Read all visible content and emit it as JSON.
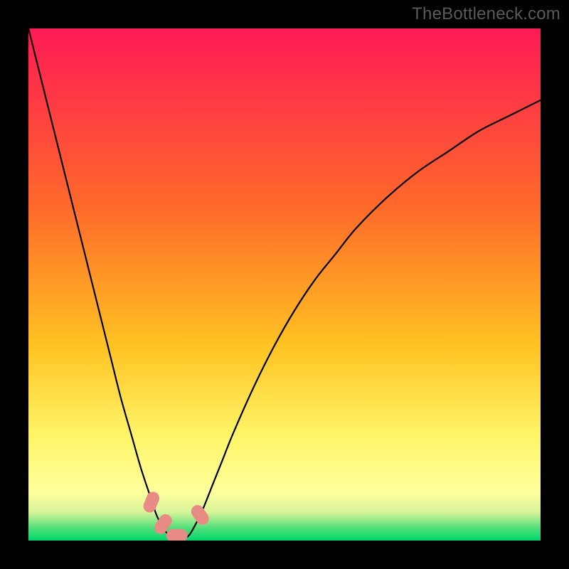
{
  "watermark": "TheBottleneck.com",
  "chart_data": {
    "type": "line",
    "title": "",
    "xlabel": "",
    "ylabel": "",
    "xlim": [
      0,
      100
    ],
    "ylim": [
      0,
      100
    ],
    "grid": false,
    "legend": false,
    "background_gradient": {
      "stops": [
        {
          "offset": 0.0,
          "color": "#ff1a55"
        },
        {
          "offset": 0.35,
          "color": "#ff6a2a"
        },
        {
          "offset": 0.62,
          "color": "#ffc322"
        },
        {
          "offset": 0.8,
          "color": "#fff66a"
        },
        {
          "offset": 0.905,
          "color": "#ffff9c"
        },
        {
          "offset": 0.945,
          "color": "#d6f49a"
        },
        {
          "offset": 0.975,
          "color": "#53e07a"
        },
        {
          "offset": 1.0,
          "color": "#00d66a"
        }
      ]
    },
    "series": [
      {
        "name": "bottleneck-curve",
        "x": [
          0.0,
          2.0,
          4.0,
          6.0,
          8.0,
          10.0,
          12.0,
          14.0,
          16.0,
          18.0,
          20.0,
          22.0,
          24.0,
          25.0,
          26.0,
          27.0,
          28.0,
          29.0,
          30.0,
          31.0,
          32.0,
          34.0,
          36.0,
          38.0,
          40.0,
          44.0,
          48.0,
          52.0,
          56.0,
          60.0,
          64.0,
          70.0,
          76.0,
          82.0,
          88.0,
          94.0,
          100.0
        ],
        "y": [
          100.0,
          92.0,
          84.0,
          76.0,
          68.0,
          60.0,
          52.0,
          44.0,
          36.0,
          28.0,
          21.0,
          14.0,
          8.0,
          5.0,
          3.0,
          1.5,
          0.7,
          0.3,
          0.3,
          0.7,
          2.0,
          6.0,
          11.0,
          16.0,
          21.0,
          30.0,
          38.0,
          45.0,
          51.0,
          56.0,
          61.0,
          67.0,
          72.0,
          76.0,
          80.0,
          83.0,
          86.0
        ]
      }
    ],
    "markers": [
      {
        "shape": "pill",
        "x": 24.0,
        "y": 7.5,
        "angle": -68,
        "color": "#e98b85"
      },
      {
        "shape": "pill",
        "x": 26.3,
        "y": 3.2,
        "angle": -55,
        "color": "#e98b85"
      },
      {
        "shape": "pill",
        "x": 29.0,
        "y": 1.0,
        "angle": 0,
        "color": "#e98b85"
      },
      {
        "shape": "pill",
        "x": 33.5,
        "y": 5.0,
        "angle": 55,
        "color": "#e98b85"
      }
    ]
  }
}
